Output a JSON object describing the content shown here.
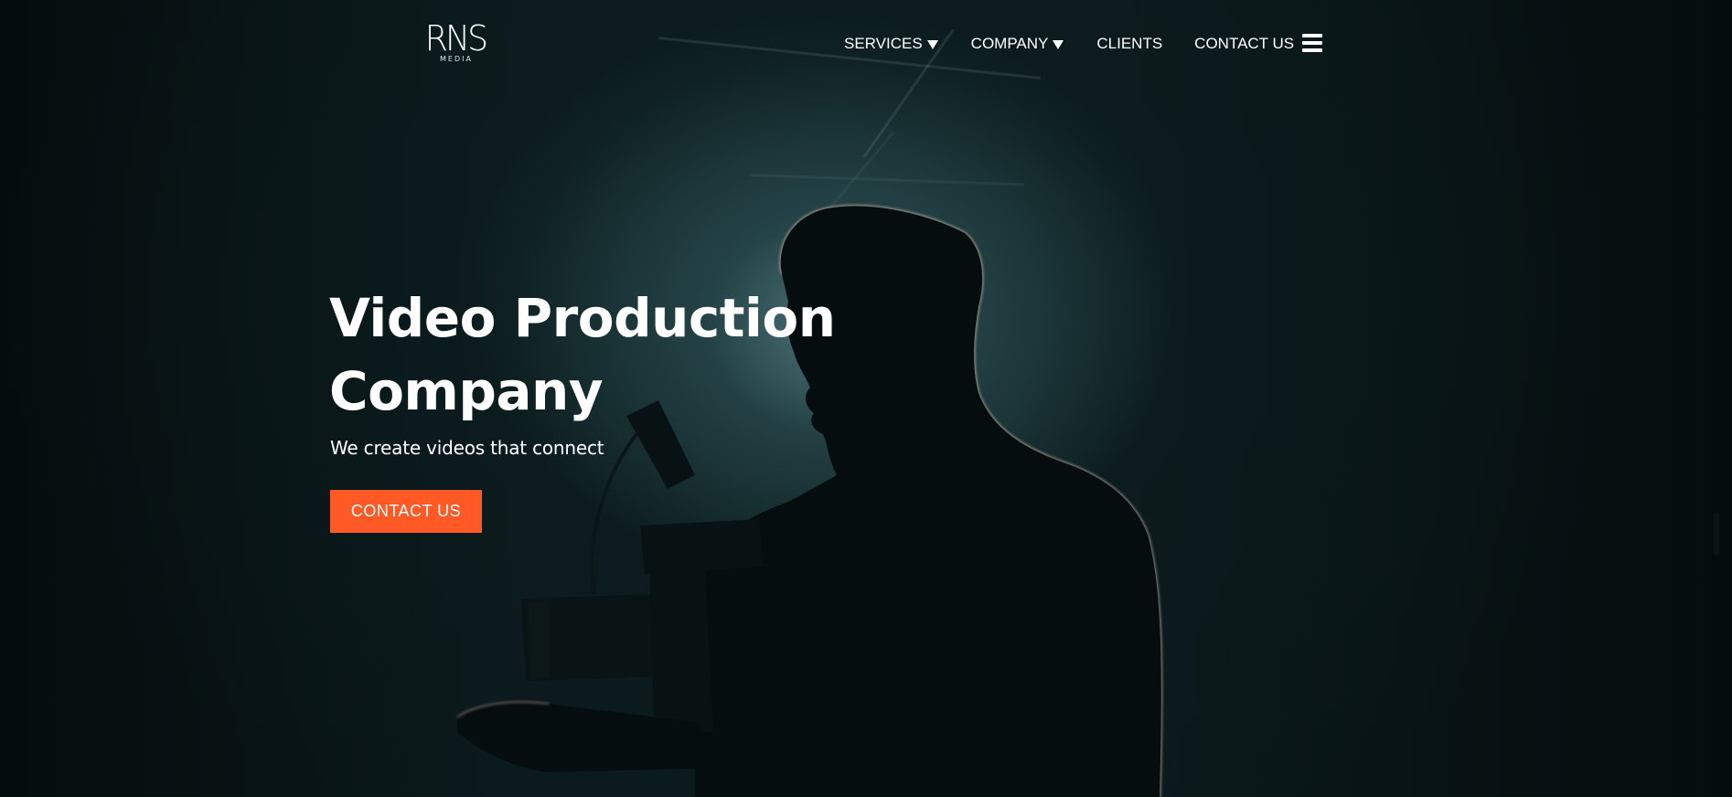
{
  "header": {
    "logo": {
      "mark": "RNS",
      "sub": "MEDIA"
    },
    "nav": {
      "services_label": "SERVICES",
      "company_label": "COMPANY",
      "clients_label": "CLIENTS",
      "contact_label": "CONTACT US"
    },
    "menu_icon": "hamburger-icon"
  },
  "hero": {
    "title_line1": "Video Production",
    "title_line2": "Company",
    "subtitle": "We create videos that connect",
    "cta_label": "CONTACT US"
  },
  "colors": {
    "accent": "#ff5a25",
    "text": "#ffffff",
    "background": "#071112"
  }
}
